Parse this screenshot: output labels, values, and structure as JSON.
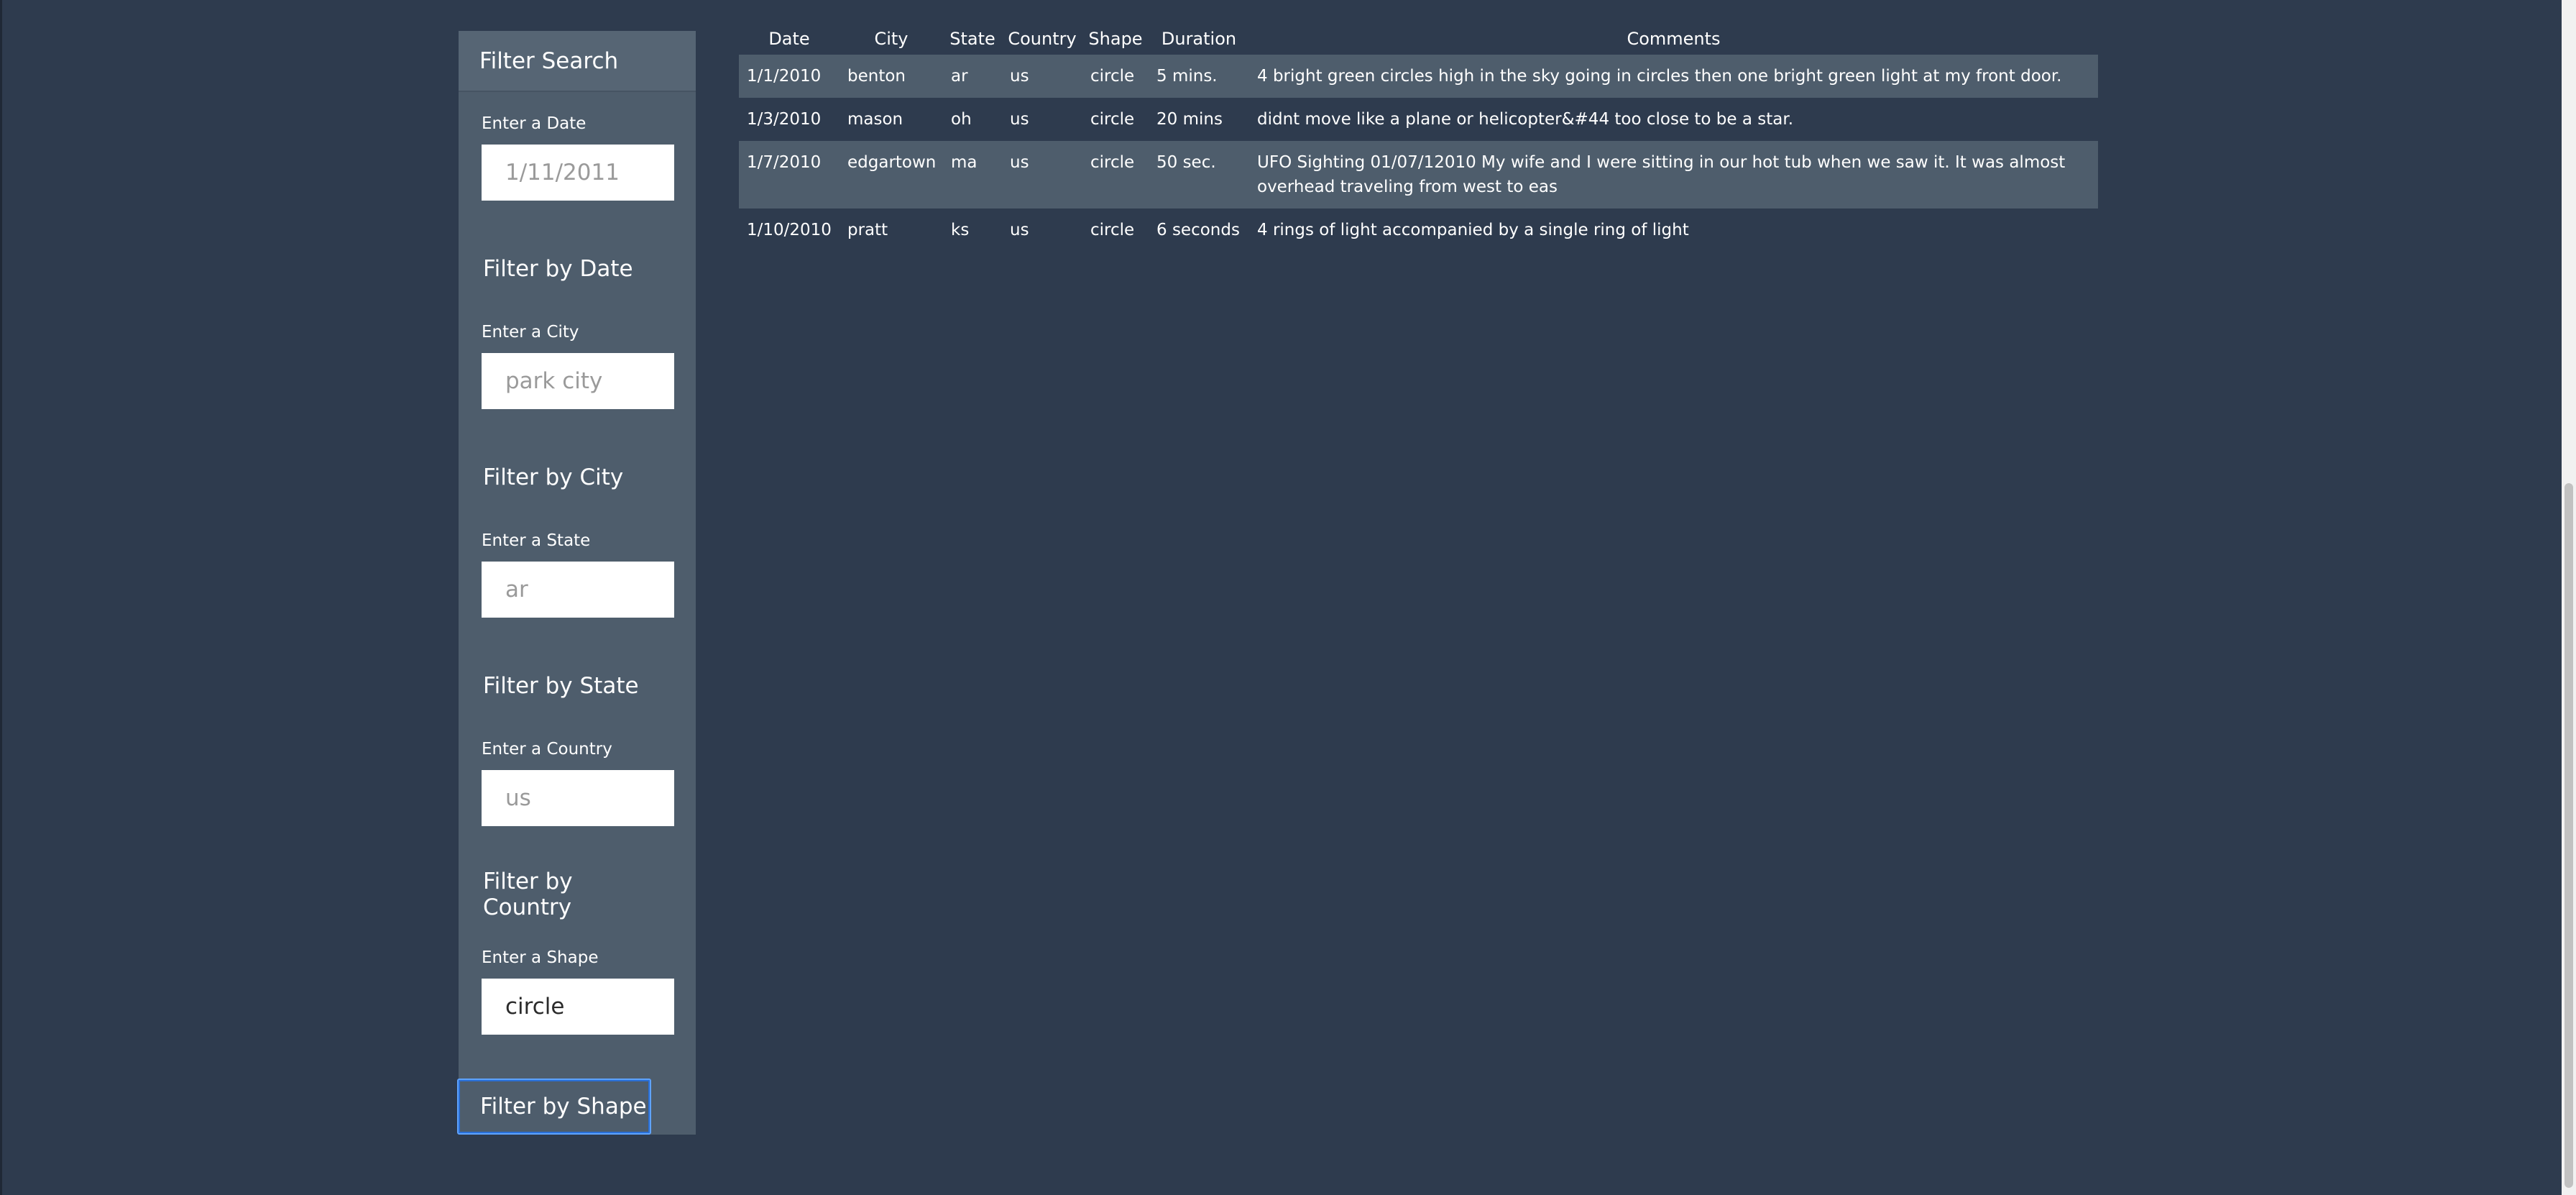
{
  "sidebar": {
    "title": "Filter Search",
    "filters": [
      {
        "label": "Enter a Date",
        "placeholder": "1/11/2011",
        "value": "",
        "button": "Filter by Date"
      },
      {
        "label": "Enter a City",
        "placeholder": "park city",
        "value": "",
        "button": "Filter by City"
      },
      {
        "label": "Enter a State",
        "placeholder": "ar",
        "value": "",
        "button": "Filter by State"
      },
      {
        "label": "Enter a Country",
        "placeholder": "us",
        "value": "",
        "button": "Filter by Country"
      },
      {
        "label": "Enter a Shape",
        "placeholder": "",
        "value": "circle",
        "button": "Filter by Shape"
      }
    ]
  },
  "table": {
    "columns": [
      "Date",
      "City",
      "State",
      "Country",
      "Shape",
      "Duration",
      "Comments"
    ],
    "rows": [
      [
        "1/1/2010",
        "benton",
        "ar",
        "us",
        "circle",
        "5 mins.",
        "4 bright green circles high in the sky going in circles then one bright green light at my front door."
      ],
      [
        "1/3/2010",
        "mason",
        "oh",
        "us",
        "circle",
        "20 mins",
        "didnt move like a plane or helicopter&#44 too close to be a star."
      ],
      [
        "1/7/2010",
        "edgartown",
        "ma",
        "us",
        "circle",
        "50 sec.",
        "UFO Sighting 01/07/12010 My wife and I were sitting in our hot tub when we saw it. It was almost overhead traveling from west to eas"
      ],
      [
        "1/10/2010",
        "pratt",
        "ks",
        "us",
        "circle",
        "6 seconds",
        "4 rings of light accompanied by a single ring of light"
      ]
    ]
  }
}
